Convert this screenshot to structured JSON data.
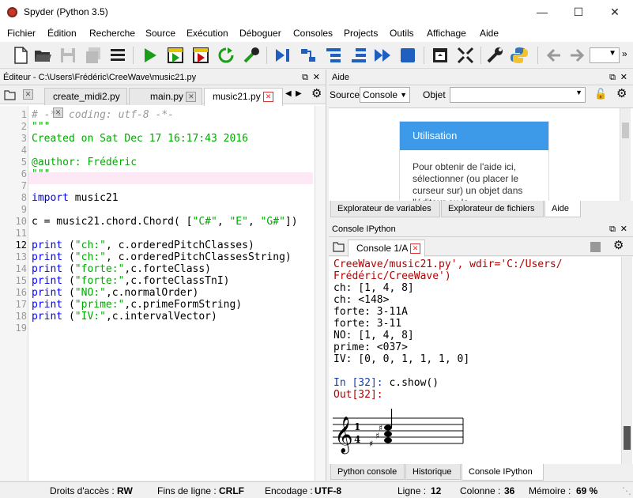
{
  "window": {
    "title": "Spyder (Python 3.5)"
  },
  "menu": [
    "Fichier",
    "Édition",
    "Recherche",
    "Source",
    "Exécution",
    "Déboguer",
    "Consoles",
    "Projects",
    "Outils",
    "Affichage",
    "Aide"
  ],
  "editor": {
    "header": "Éditeur - C:\\Users\\Frédéric\\CreeWave\\music21.py",
    "tabs": [
      "create_midi2.py",
      "main.py",
      "music21.py"
    ],
    "lines": [
      "# -*- coding: utf-8 -*-",
      "\"\"\"",
      "Created on Sat Dec 17 16:17:43 2016",
      "",
      "@author: Frédéric",
      "\"\"\"",
      "",
      "import music21",
      "",
      "c = music21.chord.Chord( [\"C#\", \"E\", \"G#\"])",
      "",
      "print (\"ch:\", c.orderedPitchClasses)",
      "print (\"ch:\", c.orderedPitchClassesString)",
      "print (\"forte:\",c.forteClass)",
      "print (\"forte:\",c.forteClassTnI)",
      "print (\"NO:\",c.normalOrder)",
      "print (\"prime:\",c.primeFormString)",
      "print (\"IV:\",c.intervalVector)",
      ""
    ],
    "line_numbers": [
      "1",
      "2",
      "3",
      "4",
      "5",
      "6",
      "7",
      "8",
      "9",
      "10",
      "11",
      "12",
      "13",
      "14",
      "15",
      "16",
      "17",
      "18",
      "19"
    ]
  },
  "help": {
    "header": "Aide",
    "source_label": "Source",
    "source_value": "Console",
    "object_label": "Objet",
    "card_title": "Utilisation",
    "card_text": "Pour obtenir de l'aide ici, sélectionner (ou placer le curseur sur) un objet dans l'éditeur ou la",
    "tabs": [
      "Explorateur de variables",
      "Explorateur de fichiers",
      "Aide"
    ]
  },
  "console": {
    "header": "Console IPython",
    "tab": "Console 1/A",
    "line_path1": "CreeWave/music21.py', wdir='C:/Users/",
    "line_path2": "Frédéric/CreeWave')",
    "out": [
      "ch: [1, 4, 8]",
      "ch: <148>",
      "forte: 3-11A",
      "forte: 3-11",
      "NO: [1, 4, 8]",
      "prime: <037>",
      "IV: [0, 0, 1, 1, 1, 0]"
    ],
    "in_prompt": "In [32]:",
    "in_cmd": " c.show()",
    "out_prompt": "Out[32]:",
    "bottom_tabs": [
      "Python console",
      "Historique",
      "Console IPython"
    ]
  },
  "status": {
    "access_label": "Droits d'accès :",
    "access_value": "RW",
    "eol_label": "Fins de ligne :",
    "eol_value": "CRLF",
    "enc_label": "Encodage :",
    "enc_value": "UTF-8",
    "line_label": "Ligne :",
    "line_value": "12",
    "col_label": "Colonne :",
    "col_value": "36",
    "mem_label": "Mémoire :",
    "mem_value": "69 %"
  }
}
